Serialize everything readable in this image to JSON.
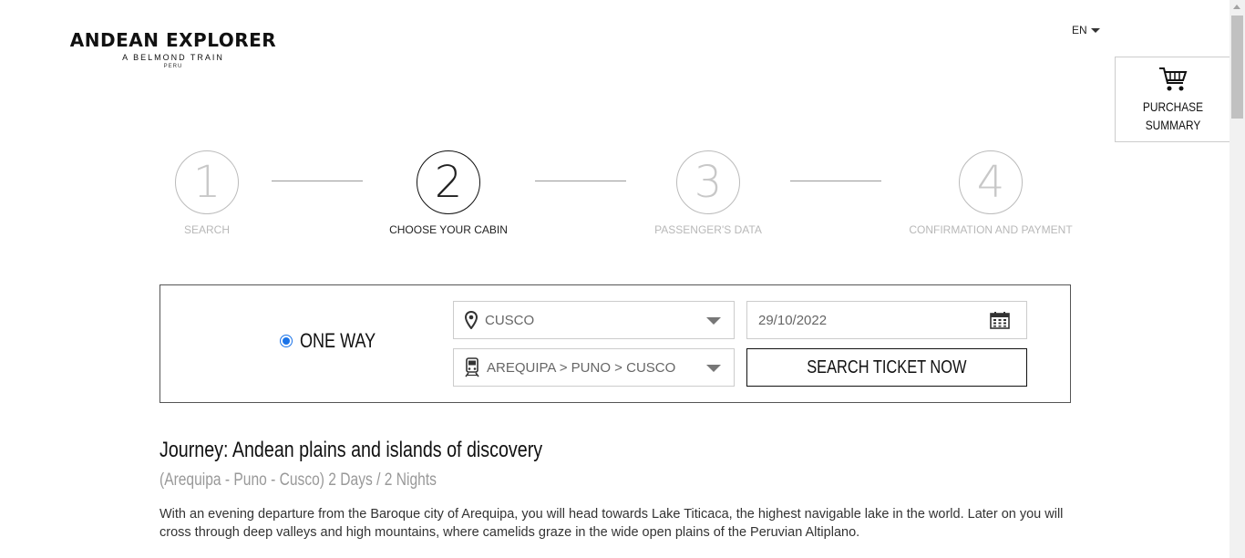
{
  "logo": {
    "main": "ANDEAN EXPLORER",
    "sub": "A BELMOND TRAIN",
    "country": "PERU"
  },
  "language": {
    "current": "EN",
    "icon": "caret-down-icon"
  },
  "purchase_summary": {
    "line1": "PURCHASE",
    "line2": "SUMMARY",
    "icon": "cart-icon"
  },
  "steps": [
    {
      "number": "1",
      "label": "SEARCH",
      "active": false
    },
    {
      "number": "2",
      "label": "CHOOSE YOUR CABIN",
      "active": true
    },
    {
      "number": "3",
      "label": "PASSENGER'S DATA",
      "active": false
    },
    {
      "number": "4",
      "label": "CONFIRMATION AND PAYMENT",
      "active": false
    }
  ],
  "search": {
    "trip_type": "ONE WAY",
    "destination": "CUSCO",
    "date": "29/10/2022",
    "route": "AREQUIPA > PUNO > CUSCO",
    "button": "SEARCH TICKET NOW"
  },
  "journey": {
    "title": "Journey: Andean plains and islands of discovery",
    "subtitle": "(Arequipa - Puno - Cusco) 2 Days / 2 Nights",
    "description": "With an evening departure from the Baroque city of Arequipa, you will head towards Lake Titicaca, the highest navigable lake in the world. Later on you will cross through deep valleys and high mountains, where camelids graze in the wide open plains of the Peruvian Altiplano."
  },
  "colors": {
    "accent": "#1a73e8",
    "text": "#111111",
    "muted": "#b8b8b8"
  }
}
